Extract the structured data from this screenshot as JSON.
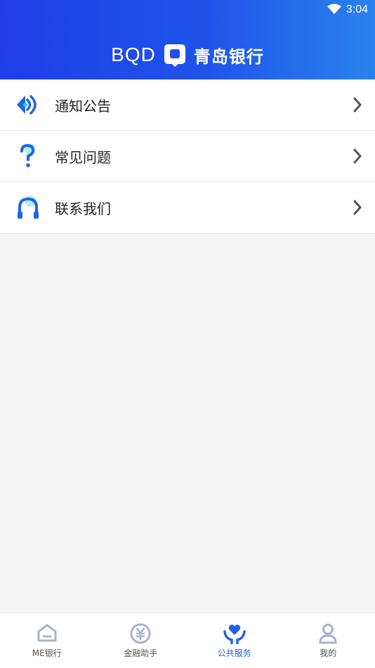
{
  "status_bar": {
    "time": "3:04"
  },
  "header": {
    "brand_en": "BQD",
    "brand_cn": "青岛银行"
  },
  "menu": [
    {
      "label": "通知公告",
      "icon": "announcement-speaker-icon"
    },
    {
      "label": "常见问题",
      "icon": "question-mark-icon"
    },
    {
      "label": "联系我们",
      "icon": "headset-icon"
    }
  ],
  "tabbar": [
    {
      "label": "ME银行",
      "icon": "home-icon",
      "active": false
    },
    {
      "label": "金融助手",
      "icon": "yuan-coin-icon",
      "active": false
    },
    {
      "label": "公共服务",
      "icon": "heart-hands-icon",
      "active": true
    },
    {
      "label": "我的",
      "icon": "person-icon",
      "active": false
    }
  ],
  "colors": {
    "header_gradient_start": "#1f3ee8",
    "header_gradient_end": "#2a82ec",
    "accent": "#1f64e8",
    "icon_cyan": "#25d0c8",
    "icon_inactive": "#aab2cf"
  }
}
